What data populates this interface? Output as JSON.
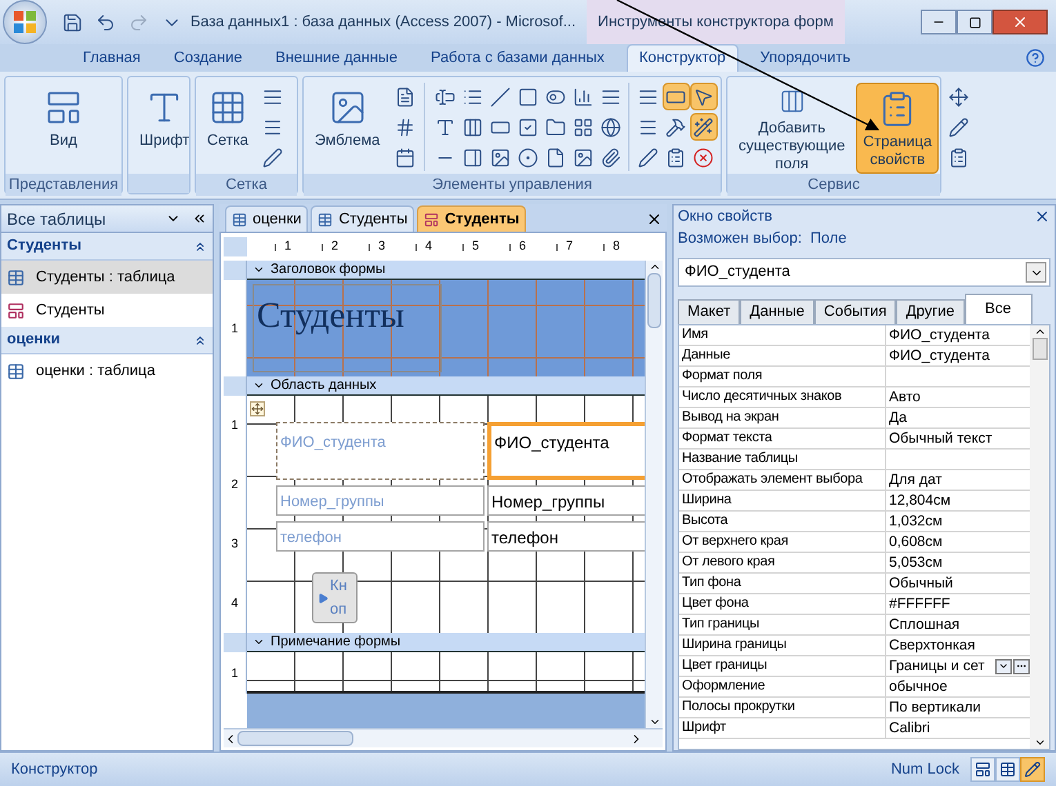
{
  "window": {
    "title": "База данных1 : база данных (Access 2007) - Microsof...",
    "context_label": "Инструменты конструктора форм"
  },
  "ribbon_tabs": [
    {
      "label": "Главная",
      "selected": false
    },
    {
      "label": "Создание",
      "selected": false
    },
    {
      "label": "Внешние данные",
      "selected": false
    },
    {
      "label": "Работа с базами данных",
      "selected": false
    },
    {
      "label": "Конструктор",
      "selected": true
    },
    {
      "label": "Упорядочить",
      "selected": false
    }
  ],
  "ribbon": {
    "views": {
      "label": "Представления",
      "button": "Вид"
    },
    "font": {
      "button": "Шрифт"
    },
    "grid": {
      "label": "Сетка",
      "button": "Сетка"
    },
    "controls": {
      "label": "Элементы управления",
      "logo_button": "Эмблема",
      "tool_states": [
        {
          "on": false
        },
        {
          "on": true
        },
        {
          "on": true
        },
        {
          "on": false
        },
        {
          "on": false
        },
        {
          "on": true
        },
        {
          "on": false
        },
        {
          "on": false
        },
        {
          "on": false
        }
      ]
    },
    "tools": {
      "label": "Сервис",
      "buttons": [
        {
          "label": "Добавить существующие поля",
          "selected": false
        },
        {
          "label": "Страница свойств",
          "selected": true
        }
      ]
    }
  },
  "nav_pane": {
    "title": "Все таблицы",
    "groups": [
      {
        "title": "Студенты",
        "items": [
          {
            "label": "Студенты : таблица",
            "kind": "table",
            "selected": true
          },
          {
            "label": "Студенты",
            "kind": "form",
            "selected": false
          }
        ]
      },
      {
        "title": "оценки",
        "items": [
          {
            "label": "оценки : таблица",
            "kind": "table",
            "selected": false
          }
        ]
      }
    ]
  },
  "document_tabs": [
    {
      "label": "оценки",
      "kind": "table",
      "selected": false
    },
    {
      "label": "Студенты",
      "kind": "table",
      "selected": false
    },
    {
      "label": "Студенты",
      "kind": "form",
      "selected": true
    }
  ],
  "ruler": [
    "1",
    "2",
    "3",
    "4",
    "5",
    "6",
    "7",
    "8"
  ],
  "form": {
    "header": {
      "title": "Заголовок формы",
      "ruler": [
        "1"
      ],
      "caption": "Студенты"
    },
    "detail": {
      "title": "Область данных",
      "ruler": [
        "1",
        "2",
        "3",
        "4"
      ],
      "fields": [
        {
          "label": "ФИО_студента",
          "textbox": "ФИО_студента",
          "selected": true
        },
        {
          "label": "Номер_группы",
          "textbox": "Номер_группы",
          "selected": false
        },
        {
          "label": "телефон",
          "textbox": "телефон",
          "selected": false
        }
      ],
      "button": "Кноп"
    },
    "footer": {
      "title": "Примечание формы",
      "ruler": [
        "1"
      ]
    }
  },
  "property_sheet": {
    "title": "Окно свойств",
    "selection_type": "Возможен выбор:  Поле",
    "selected_object": "ФИО_студента",
    "tabs": [
      {
        "label": "Макет",
        "selected": false
      },
      {
        "label": "Данные",
        "selected": false
      },
      {
        "label": "События",
        "selected": false
      },
      {
        "label": "Другие",
        "selected": false
      },
      {
        "label": "Все",
        "selected": true
      }
    ],
    "rows": [
      {
        "name": "Имя",
        "value": "ФИО_студента",
        "kind": "text"
      },
      {
        "name": "Данные",
        "value": "ФИО_студента",
        "kind": "text"
      },
      {
        "name": "Формат поля",
        "kind": "text"
      },
      {
        "name": "Число десятичных знаков",
        "value": "Авто",
        "kind": "text"
      },
      {
        "name": "Вывод на экран",
        "value": "Да",
        "kind": "text"
      },
      {
        "name": "Формат текста",
        "value": "Обычный текст",
        "kind": "text"
      },
      {
        "name": "Название таблицы",
        "kind": "text"
      },
      {
        "name": "Отображать элемент выбора",
        "value": "Для дат",
        "kind": "text"
      },
      {
        "name": "Ширина",
        "value": "12,804см",
        "kind": "text"
      },
      {
        "name": "Высота",
        "value": "1,032см",
        "kind": "text"
      },
      {
        "name": "От верхнего края",
        "value": "0,608см",
        "kind": "text"
      },
      {
        "name": "От левого края",
        "value": "5,053см",
        "kind": "text"
      },
      {
        "name": "Тип фона",
        "value": "Обычный",
        "kind": "text"
      },
      {
        "name": "Цвет фона",
        "value": "#FFFFFF",
        "kind": "text"
      },
      {
        "name": "Тип границы",
        "value": "Сплошная",
        "kind": "text"
      },
      {
        "name": "Ширина границы",
        "value": "Сверхтонкая",
        "kind": "text"
      },
      {
        "name": "Цвет границы",
        "value": "Границы и сет",
        "kind": "builder"
      },
      {
        "name": "Оформление",
        "value": "обычное",
        "kind": "text"
      },
      {
        "name": "Полосы прокрутки",
        "value": "По вертикали",
        "kind": "text"
      },
      {
        "name": "Шрифт",
        "value": "Calibri",
        "kind": "text"
      }
    ]
  },
  "status_bar": {
    "mode": "Конструктор",
    "num_lock": "Num Lock",
    "view_buttons": [
      {
        "selected": false
      },
      {
        "selected": false
      },
      {
        "selected": true
      }
    ]
  }
}
